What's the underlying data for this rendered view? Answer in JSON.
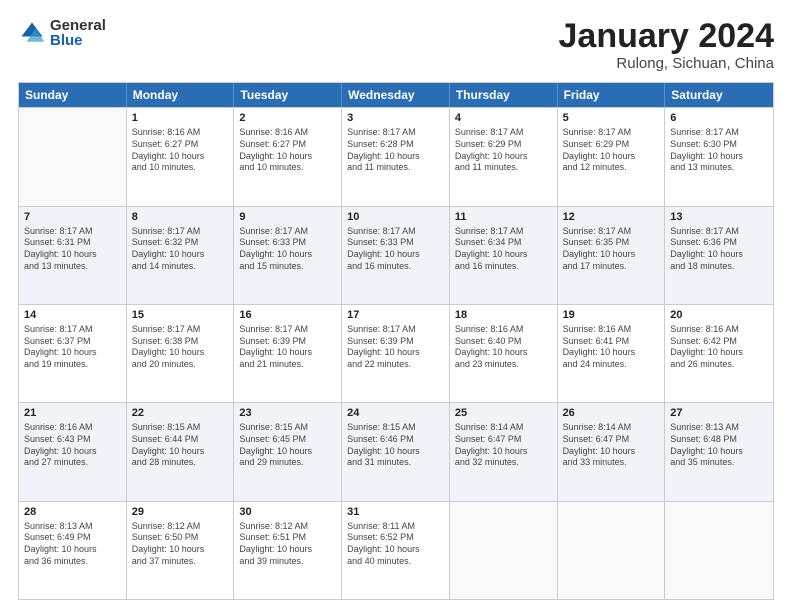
{
  "logo": {
    "general": "General",
    "blue": "Blue"
  },
  "title": "January 2024",
  "location": "Rulong, Sichuan, China",
  "header_days": [
    "Sunday",
    "Monday",
    "Tuesday",
    "Wednesday",
    "Thursday",
    "Friday",
    "Saturday"
  ],
  "weeks": [
    [
      {
        "day": "",
        "info": ""
      },
      {
        "day": "1",
        "info": "Sunrise: 8:16 AM\nSunset: 6:27 PM\nDaylight: 10 hours\nand 10 minutes."
      },
      {
        "day": "2",
        "info": "Sunrise: 8:16 AM\nSunset: 6:27 PM\nDaylight: 10 hours\nand 10 minutes."
      },
      {
        "day": "3",
        "info": "Sunrise: 8:17 AM\nSunset: 6:28 PM\nDaylight: 10 hours\nand 11 minutes."
      },
      {
        "day": "4",
        "info": "Sunrise: 8:17 AM\nSunset: 6:29 PM\nDaylight: 10 hours\nand 11 minutes."
      },
      {
        "day": "5",
        "info": "Sunrise: 8:17 AM\nSunset: 6:29 PM\nDaylight: 10 hours\nand 12 minutes."
      },
      {
        "day": "6",
        "info": "Sunrise: 8:17 AM\nSunset: 6:30 PM\nDaylight: 10 hours\nand 13 minutes."
      }
    ],
    [
      {
        "day": "7",
        "info": "Sunrise: 8:17 AM\nSunset: 6:31 PM\nDaylight: 10 hours\nand 13 minutes."
      },
      {
        "day": "8",
        "info": "Sunrise: 8:17 AM\nSunset: 6:32 PM\nDaylight: 10 hours\nand 14 minutes."
      },
      {
        "day": "9",
        "info": "Sunrise: 8:17 AM\nSunset: 6:33 PM\nDaylight: 10 hours\nand 15 minutes."
      },
      {
        "day": "10",
        "info": "Sunrise: 8:17 AM\nSunset: 6:33 PM\nDaylight: 10 hours\nand 16 minutes."
      },
      {
        "day": "11",
        "info": "Sunrise: 8:17 AM\nSunset: 6:34 PM\nDaylight: 10 hours\nand 16 minutes."
      },
      {
        "day": "12",
        "info": "Sunrise: 8:17 AM\nSunset: 6:35 PM\nDaylight: 10 hours\nand 17 minutes."
      },
      {
        "day": "13",
        "info": "Sunrise: 8:17 AM\nSunset: 6:36 PM\nDaylight: 10 hours\nand 18 minutes."
      }
    ],
    [
      {
        "day": "14",
        "info": "Sunrise: 8:17 AM\nSunset: 6:37 PM\nDaylight: 10 hours\nand 19 minutes."
      },
      {
        "day": "15",
        "info": "Sunrise: 8:17 AM\nSunset: 6:38 PM\nDaylight: 10 hours\nand 20 minutes."
      },
      {
        "day": "16",
        "info": "Sunrise: 8:17 AM\nSunset: 6:39 PM\nDaylight: 10 hours\nand 21 minutes."
      },
      {
        "day": "17",
        "info": "Sunrise: 8:17 AM\nSunset: 6:39 PM\nDaylight: 10 hours\nand 22 minutes."
      },
      {
        "day": "18",
        "info": "Sunrise: 8:16 AM\nSunset: 6:40 PM\nDaylight: 10 hours\nand 23 minutes."
      },
      {
        "day": "19",
        "info": "Sunrise: 8:16 AM\nSunset: 6:41 PM\nDaylight: 10 hours\nand 24 minutes."
      },
      {
        "day": "20",
        "info": "Sunrise: 8:16 AM\nSunset: 6:42 PM\nDaylight: 10 hours\nand 26 minutes."
      }
    ],
    [
      {
        "day": "21",
        "info": "Sunrise: 8:16 AM\nSunset: 6:43 PM\nDaylight: 10 hours\nand 27 minutes."
      },
      {
        "day": "22",
        "info": "Sunrise: 8:15 AM\nSunset: 6:44 PM\nDaylight: 10 hours\nand 28 minutes."
      },
      {
        "day": "23",
        "info": "Sunrise: 8:15 AM\nSunset: 6:45 PM\nDaylight: 10 hours\nand 29 minutes."
      },
      {
        "day": "24",
        "info": "Sunrise: 8:15 AM\nSunset: 6:46 PM\nDaylight: 10 hours\nand 31 minutes."
      },
      {
        "day": "25",
        "info": "Sunrise: 8:14 AM\nSunset: 6:47 PM\nDaylight: 10 hours\nand 32 minutes."
      },
      {
        "day": "26",
        "info": "Sunrise: 8:14 AM\nSunset: 6:47 PM\nDaylight: 10 hours\nand 33 minutes."
      },
      {
        "day": "27",
        "info": "Sunrise: 8:13 AM\nSunset: 6:48 PM\nDaylight: 10 hours\nand 35 minutes."
      }
    ],
    [
      {
        "day": "28",
        "info": "Sunrise: 8:13 AM\nSunset: 6:49 PM\nDaylight: 10 hours\nand 36 minutes."
      },
      {
        "day": "29",
        "info": "Sunrise: 8:12 AM\nSunset: 6:50 PM\nDaylight: 10 hours\nand 37 minutes."
      },
      {
        "day": "30",
        "info": "Sunrise: 8:12 AM\nSunset: 6:51 PM\nDaylight: 10 hours\nand 39 minutes."
      },
      {
        "day": "31",
        "info": "Sunrise: 8:11 AM\nSunset: 6:52 PM\nDaylight: 10 hours\nand 40 minutes."
      },
      {
        "day": "",
        "info": ""
      },
      {
        "day": "",
        "info": ""
      },
      {
        "day": "",
        "info": ""
      }
    ]
  ]
}
